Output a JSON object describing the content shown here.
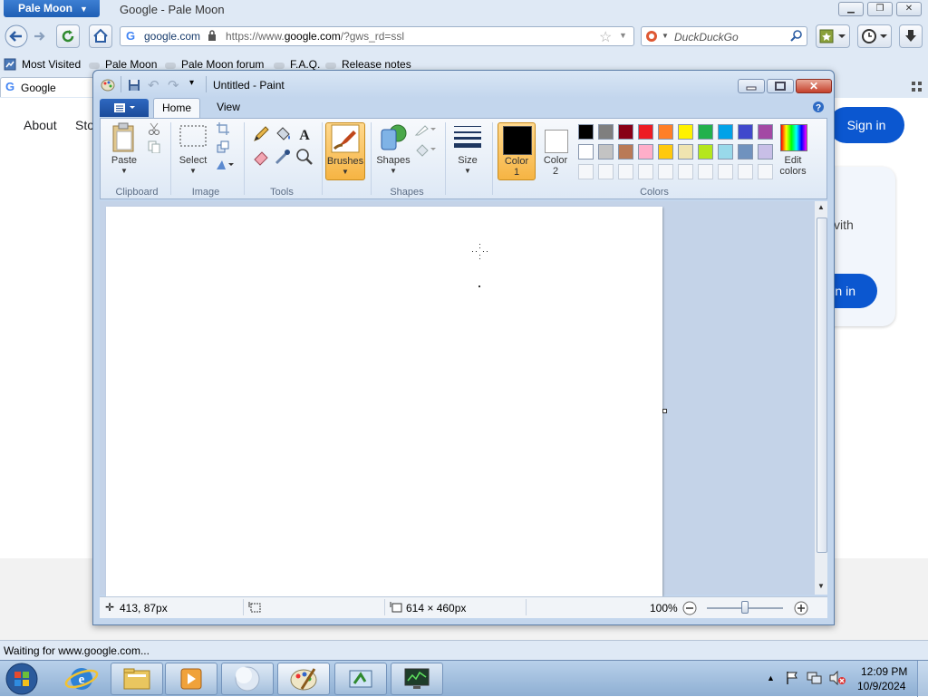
{
  "browser": {
    "app_button": "Pale Moon",
    "window_title": "Google - Pale Moon",
    "url_domain": "google.com",
    "url_prefix": "https://www.",
    "url_host": "google.com",
    "url_suffix": "/?gws_rd=ssl",
    "search_placeholder": "DuckDuckGo",
    "bookmarks": [
      "Most Visited",
      "Pale Moon",
      "Pale Moon forum",
      "F.A.Q.",
      "Release notes"
    ],
    "tab_title": "Google",
    "status": "Waiting for www.google.com..."
  },
  "google": {
    "about": "About",
    "store": "Sto",
    "sign_in": "Sign in",
    "card_text": "vith",
    "card_button": "n in"
  },
  "paint": {
    "title": "Untitled - Paint",
    "tabs": [
      "Home",
      "View"
    ],
    "clipboard": {
      "paste": "Paste",
      "group": "Clipboard"
    },
    "image": {
      "select": "Select",
      "group": "Image"
    },
    "tools": {
      "group": "Tools"
    },
    "brushes": "Brushes",
    "shapes": {
      "label": "Shapes",
      "group": "Shapes"
    },
    "size": "Size",
    "color1": [
      "Color",
      "1"
    ],
    "color2": [
      "Color",
      "2"
    ],
    "edit_colors": [
      "Edit",
      "colors"
    ],
    "colors_group": "Colors",
    "palette_row1": [
      "#000000",
      "#7f7f7f",
      "#880015",
      "#ed1c24",
      "#ff7f27",
      "#fff200",
      "#22b14c",
      "#00a2e8",
      "#3f48cc",
      "#a349a4"
    ],
    "palette_row2": [
      "#ffffff",
      "#c3c3c3",
      "#b97a57",
      "#ffaec9",
      "#ffc90e",
      "#efe4b0",
      "#b5e61d",
      "#99d9ea",
      "#7092be",
      "#c8bfe7"
    ],
    "status": {
      "cursor_pos": "413, 87px",
      "canvas_size": "614 × 460px",
      "zoom": "100%"
    }
  },
  "taskbar": {
    "time": "12:09 PM",
    "date": "10/9/2024"
  }
}
